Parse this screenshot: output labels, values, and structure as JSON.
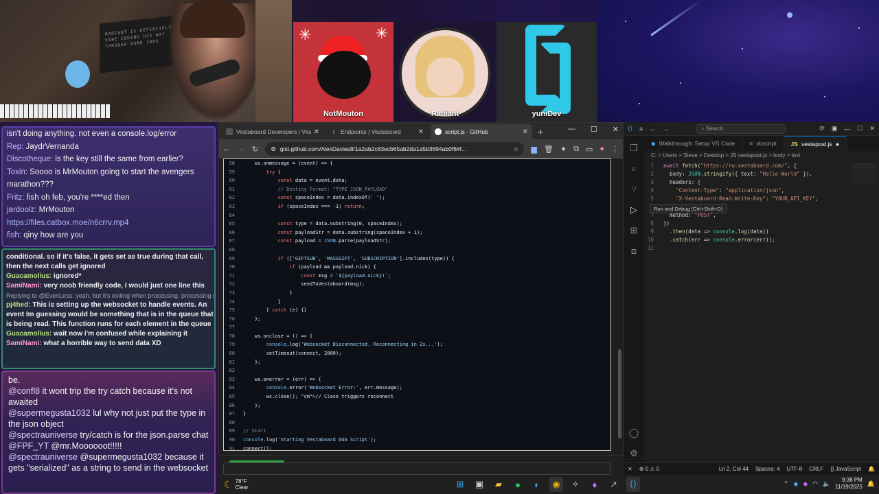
{
  "overlay": {
    "poster_text": "RADIANT IS DEFINITELY VIBE CODING HIS WAY THROUGH WORK 100%",
    "tiles": [
      {
        "name": "NotMouton"
      },
      {
        "name": "Radiant"
      },
      {
        "name": "yuniDev"
      }
    ]
  },
  "chat1": [
    {
      "user": "",
      "text": "isn't doing anything. not even a console.log/error"
    },
    {
      "user": "Rep:",
      "text": " JaydrVernanda"
    },
    {
      "user": "Discotheque:",
      "text": " is the key still the same from earlier?"
    },
    {
      "user": "Toxin:",
      "text": " Soooo is MrMouton going to start the avengers"
    },
    {
      "user": "",
      "text": "marathon???"
    },
    {
      "user": "Fritz:",
      "text": " fish oh feb, you're ****ed then"
    },
    {
      "user": "jardoolz:",
      "text": " MrMouton"
    },
    {
      "user": "",
      "text": "https://files.catbox.moe/n6crrv.mp4"
    },
    {
      "user": "fish:",
      "text": " qiny how are you"
    }
  ],
  "chat2": [
    {
      "user": "",
      "text": "conditional. so if it's false, it gets set as true during that call, then the next calls get ignored"
    },
    {
      "user": "Guacamolius:",
      "text": " ignored*"
    },
    {
      "user": "SamiNami:",
      "text": " very noob friendly code, I would just one line this"
    },
    {
      "reply": "Replying to @EvenLess: yeah, but it's exiting when processing. processing se..."
    },
    {
      "user": "pj4hed:",
      "text": " This is setting up the websocket to handle events. An event Im guessing would be something that is in the queue that is being read. This function runs for each element in the queue"
    },
    {
      "user": "Guacamolius:",
      "text": " wait now i'm confused while explaining it"
    },
    {
      "user": "SamiNami:",
      "text": " what a horrible way to send data XD"
    }
  ],
  "chat3": [
    {
      "user": "",
      "text": "be."
    },
    {
      "user": "@confl8",
      "text": " it wont trip the try catch because it's not awaited"
    },
    {
      "user": "@supermegusta1032",
      "text": " lul why not just put the type in the json object"
    },
    {
      "user": "@spectrauniverse",
      "text": " try/catch is for the json.parse chat"
    },
    {
      "user": "@FPF_YT",
      "text": " @mr.Moooooot!!!!!"
    },
    {
      "user": "@spectrauniverse",
      "text": " @supermegusta1032 because it gets \"serialized\" as a string to send in the websocket"
    }
  ],
  "chrome": {
    "tabs": [
      {
        "title": "Vestaboard Developers | Vesta"
      },
      {
        "title": "Endpoints | Vestaboard"
      },
      {
        "title": "script.js · GitHub"
      }
    ],
    "url": "gist.github.com/AlexDavies8/1a2ab2c83ecb65ab2da1a5b3694ab0f6#f...",
    "code": [
      {
        "n": "58",
        "t": "    ws.onmessage = (event) => {"
      },
      {
        "n": "59",
        "t": "        try {"
      },
      {
        "n": "60",
        "t": "            const data = event.data;"
      },
      {
        "n": "61",
        "t": "            // Destiny Format: \"TYPE JSON_PAYLOAD\""
      },
      {
        "n": "62",
        "t": "            const spaceIndex = data.indexOf(' ');"
      },
      {
        "n": "63",
        "t": "            if (spaceIndex === -1) return;"
      },
      {
        "n": "64",
        "t": ""
      },
      {
        "n": "65",
        "t": "            const type = data.substring(0, spaceIndex);"
      },
      {
        "n": "66",
        "t": "            const payloadStr = data.substring(spaceIndex + 1);"
      },
      {
        "n": "67",
        "t": "            const payload = JSON.parse(payloadStr);"
      },
      {
        "n": "68",
        "t": ""
      },
      {
        "n": "69",
        "t": "            if (['GIFTSUB', 'MASSGIFT', 'SUBSCRIPTION'].includes(type)) {"
      },
      {
        "n": "70",
        "t": "                if (payload && payload.nick) {"
      },
      {
        "n": "71",
        "t": "                    const msg = `${payload.nick}!`;"
      },
      {
        "n": "72",
        "t": "                    sendToVestaboard(msg);"
      },
      {
        "n": "73",
        "t": "                }"
      },
      {
        "n": "74",
        "t": "            }"
      },
      {
        "n": "75",
        "t": "        } catch (e) {}"
      },
      {
        "n": "76",
        "t": "    };"
      },
      {
        "n": "77",
        "t": ""
      },
      {
        "n": "78",
        "t": "    ws.onclose = () => {"
      },
      {
        "n": "79",
        "t": "        console.log('Websocket Disconnected. Reconnecting in 2s...');"
      },
      {
        "n": "80",
        "t": "        setTimeout(connect, 2000);"
      },
      {
        "n": "81",
        "t": "    };"
      },
      {
        "n": "82",
        "t": ""
      },
      {
        "n": "83",
        "t": "    ws.onerror = (err) => {"
      },
      {
        "n": "84",
        "t": "        console.error('Websocket Error:', err.message);"
      },
      {
        "n": "85",
        "t": "        ws.close(); // Close triggers reconnect"
      },
      {
        "n": "86",
        "t": "    };"
      },
      {
        "n": "87",
        "t": "}"
      },
      {
        "n": "88",
        "t": ""
      },
      {
        "n": "89",
        "t": "// Start"
      },
      {
        "n": "90",
        "t": "console.log('Starting Vestaboard DGG Script');"
      },
      {
        "n": "91",
        "t": "connect();"
      }
    ]
  },
  "vscode": {
    "search": "Search",
    "tabs": [
      {
        "title": "Walkthrough: Setup VS Code"
      },
      {
        "title": "vbscript"
      },
      {
        "title": "vestapost.js"
      }
    ],
    "breadcrumb": "C: > Users > Steve > Desktop > JS vestapost.js > body > text",
    "tooltip": "Run and Debug (Ctrl+Shift+D)",
    "code": [
      {
        "n": "1",
        "t": "await fetch(\"https://rw.vestaboard.com/\", {"
      },
      {
        "n": "2",
        "t": "  body: JSON.stringify({ text: \"Hello World\" }),"
      },
      {
        "n": "3",
        "t": "  headers: {"
      },
      {
        "n": "4",
        "t": "    \"Content-Type\": \"application/json\","
      },
      {
        "n": "5",
        "t": "    \"X-Vestaboard-Read-Write-Key\": \"YOUR_API_KEY\","
      },
      {
        "n": "6",
        "t": "  },"
      },
      {
        "n": "7",
        "t": "  method: \"POST\","
      },
      {
        "n": "8",
        "t": "})"
      },
      {
        "n": "9",
        "t": "  .then(data => console.log(data))"
      },
      {
        "n": "10",
        "t": "  .catch(err => console.error(err));"
      },
      {
        "n": "11",
        "t": ""
      }
    ],
    "status": {
      "errors": "⊗ 0  ⚠ 0",
      "position": "Ln 2, Col 44",
      "spaces": "Spaces: 4",
      "encoding": "UTF-8",
      "eol": "CRLF",
      "language": "{} JavaScript"
    }
  },
  "taskbar": {
    "temp": "78°F",
    "condition": "Clear",
    "time": "9:38 PM",
    "date": "11/19/2025"
  }
}
